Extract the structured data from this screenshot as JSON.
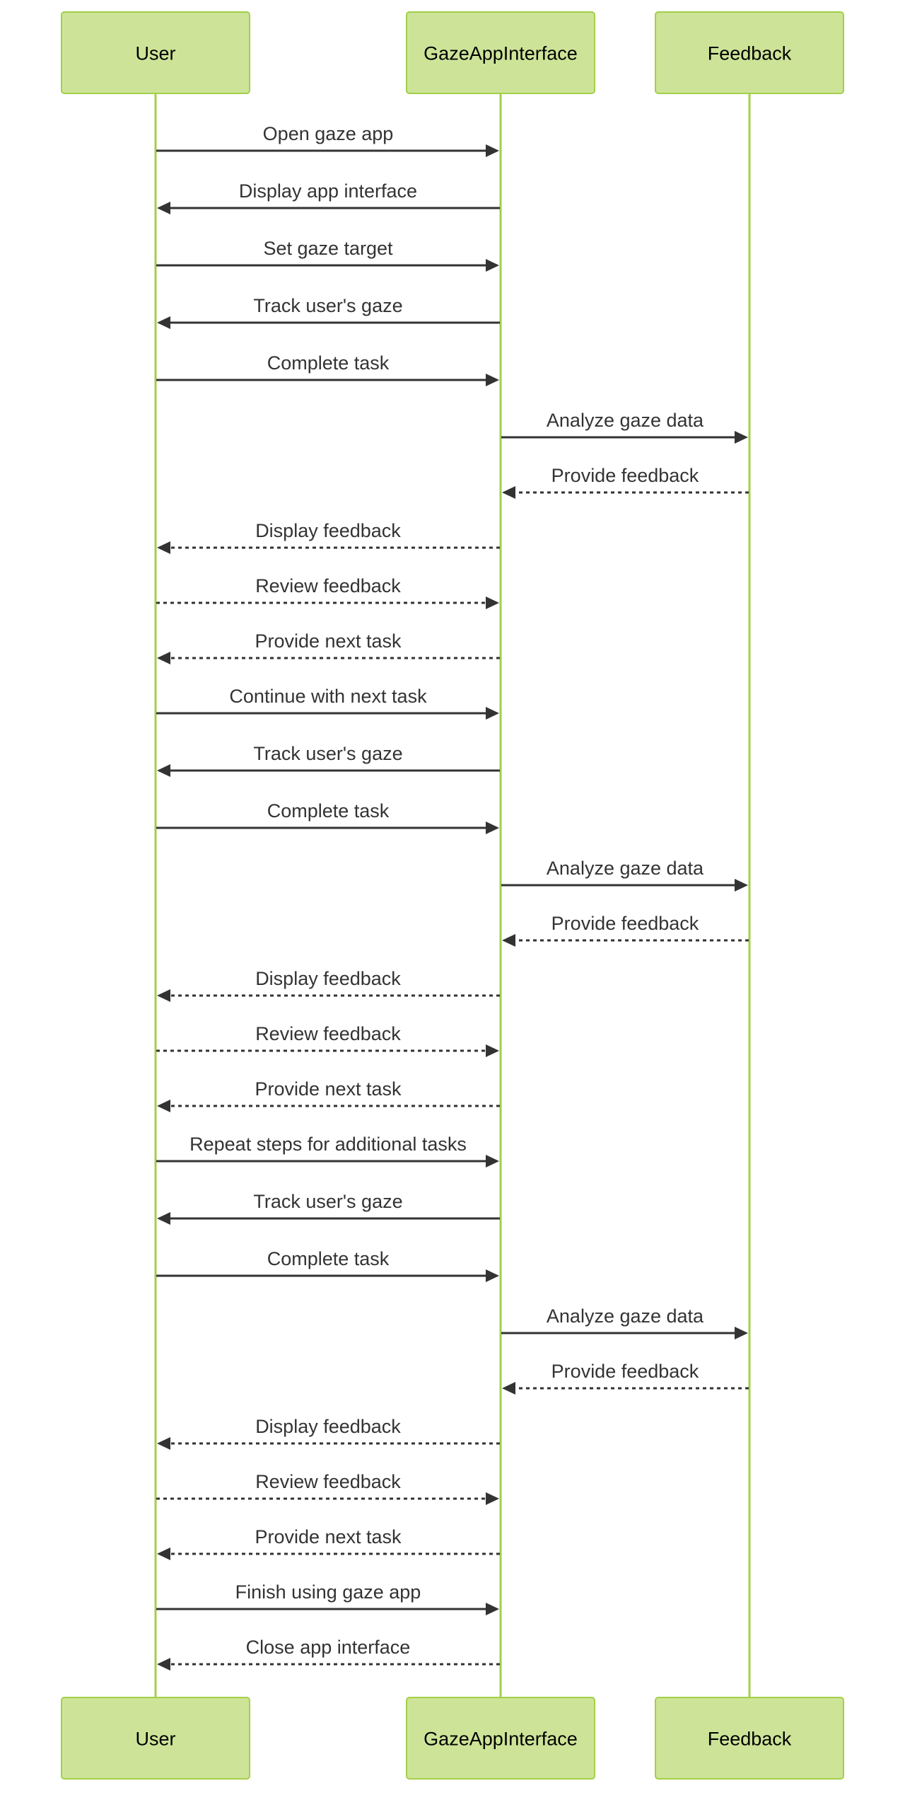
{
  "diagram": {
    "type": "sequence",
    "colors": {
      "actor_fill": "#cde498",
      "actor_stroke": "#a3cf48",
      "lifeline": "#a3cf48",
      "message": "#333333",
      "actor_text": "#000000"
    },
    "participants": [
      {
        "id": "User",
        "label": "User"
      },
      {
        "id": "GazeAppInterface",
        "label": "GazeAppInterface"
      },
      {
        "id": "Feedback",
        "label": "Feedback"
      }
    ],
    "messages": [
      {
        "from": "User",
        "to": "GazeAppInterface",
        "label": "Open gaze app",
        "style": "solid"
      },
      {
        "from": "GazeAppInterface",
        "to": "User",
        "label": "Display app interface",
        "style": "solid"
      },
      {
        "from": "User",
        "to": "GazeAppInterface",
        "label": "Set gaze target",
        "style": "solid"
      },
      {
        "from": "GazeAppInterface",
        "to": "User",
        "label": "Track user's gaze",
        "style": "solid"
      },
      {
        "from": "User",
        "to": "GazeAppInterface",
        "label": "Complete task",
        "style": "solid"
      },
      {
        "from": "GazeAppInterface",
        "to": "Feedback",
        "label": "Analyze gaze data",
        "style": "solid"
      },
      {
        "from": "Feedback",
        "to": "GazeAppInterface",
        "label": "Provide feedback",
        "style": "dashed"
      },
      {
        "from": "GazeAppInterface",
        "to": "User",
        "label": "Display feedback",
        "style": "dashed"
      },
      {
        "from": "User",
        "to": "GazeAppInterface",
        "label": "Review feedback",
        "style": "dashed"
      },
      {
        "from": "GazeAppInterface",
        "to": "User",
        "label": "Provide next task",
        "style": "dashed"
      },
      {
        "from": "User",
        "to": "GazeAppInterface",
        "label": "Continue with next task",
        "style": "solid"
      },
      {
        "from": "GazeAppInterface",
        "to": "User",
        "label": "Track user's gaze",
        "style": "solid"
      },
      {
        "from": "User",
        "to": "GazeAppInterface",
        "label": "Complete task",
        "style": "solid"
      },
      {
        "from": "GazeAppInterface",
        "to": "Feedback",
        "label": "Analyze gaze data",
        "style": "solid"
      },
      {
        "from": "Feedback",
        "to": "GazeAppInterface",
        "label": "Provide feedback",
        "style": "dashed"
      },
      {
        "from": "GazeAppInterface",
        "to": "User",
        "label": "Display feedback",
        "style": "dashed"
      },
      {
        "from": "User",
        "to": "GazeAppInterface",
        "label": "Review feedback",
        "style": "dashed"
      },
      {
        "from": "GazeAppInterface",
        "to": "User",
        "label": "Provide next task",
        "style": "dashed"
      },
      {
        "from": "User",
        "to": "GazeAppInterface",
        "label": "Repeat steps for additional tasks",
        "style": "solid"
      },
      {
        "from": "GazeAppInterface",
        "to": "User",
        "label": "Track user's gaze",
        "style": "solid"
      },
      {
        "from": "User",
        "to": "GazeAppInterface",
        "label": "Complete task",
        "style": "solid"
      },
      {
        "from": "GazeAppInterface",
        "to": "Feedback",
        "label": "Analyze gaze data",
        "style": "solid"
      },
      {
        "from": "Feedback",
        "to": "GazeAppInterface",
        "label": "Provide feedback",
        "style": "dashed"
      },
      {
        "from": "GazeAppInterface",
        "to": "User",
        "label": "Display feedback",
        "style": "dashed"
      },
      {
        "from": "User",
        "to": "GazeAppInterface",
        "label": "Review feedback",
        "style": "dashed"
      },
      {
        "from": "GazeAppInterface",
        "to": "User",
        "label": "Provide next task",
        "style": "dashed"
      },
      {
        "from": "User",
        "to": "GazeAppInterface",
        "label": "Finish using gaze app",
        "style": "solid"
      },
      {
        "from": "GazeAppInterface",
        "to": "User",
        "label": "Close app interface",
        "style": "dashed"
      }
    ]
  }
}
